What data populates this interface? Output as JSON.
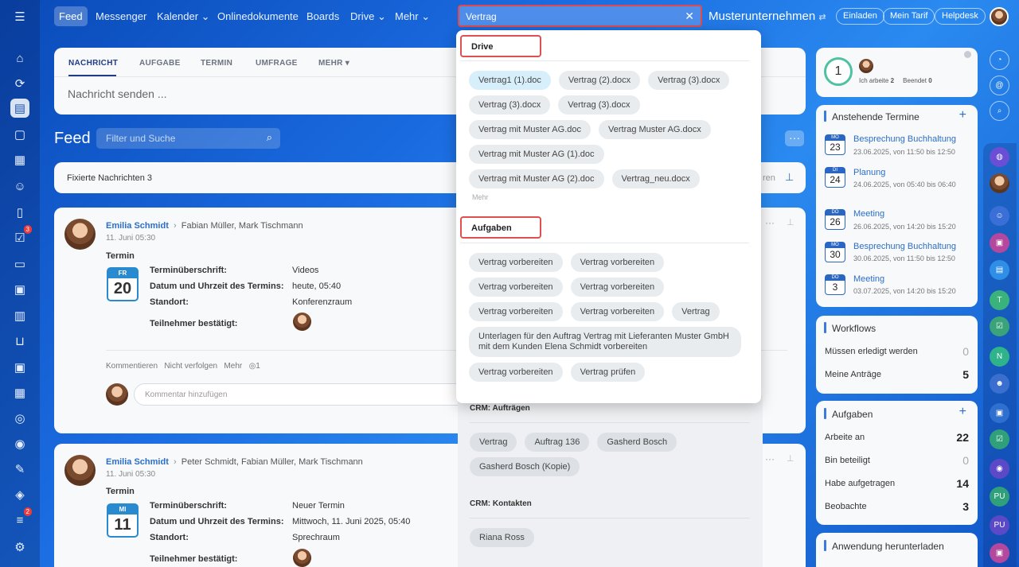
{
  "nav": {
    "items": [
      "Feed",
      "Messenger",
      "Kalender",
      "Onlinedokumente",
      "Boards",
      "Drive",
      "Mehr"
    ],
    "company": "Musterunternehmen",
    "buttons": [
      "Einladen",
      "Mein Tarif",
      "Helpdesk"
    ]
  },
  "search": {
    "value": "Vertrag"
  },
  "composer": {
    "tabs": [
      "NACHRICHT",
      "AUFGABE",
      "TERMIN",
      "UMFRAGE",
      "MEHR"
    ],
    "placeholder": "Nachricht senden ..."
  },
  "feed": {
    "title": "Feed",
    "filter_placeholder": "Filter und Suche",
    "pinned_label": "Fixierte Nachrichten",
    "pinned_count": "3",
    "pinned_right": "ren"
  },
  "posts": [
    {
      "author": "Emilia Schmidt",
      "recipients": "Fabian Müller, Mark Tischmann",
      "date": "11. Juni 05:30",
      "type": "Termin",
      "cal_month": "FR",
      "cal_day": "20",
      "label_title": "Terminüberschrift:",
      "value_title": "Videos",
      "label_datetime": "Datum und Uhrzeit des Termins:",
      "value_datetime": "heute, 05:40",
      "label_location": "Standort:",
      "value_location": "Konferenzraum",
      "label_participants": "Teilnehmer bestätigt:",
      "actions": [
        "Kommentieren",
        "Nicht verfolgen",
        "Mehr"
      ],
      "views": "1",
      "comment_placeholder": "Kommentar hinzufügen"
    },
    {
      "author": "Emilia Schmidt",
      "recipients": "Peter Schmidt, Fabian Müller, Mark Tischmann",
      "date": "11. Juni 05:30",
      "type": "Termin",
      "cal_month": "MI",
      "cal_day": "11",
      "label_title": "Terminüberschrift:",
      "value_title": "Neuer Termin",
      "label_datetime": "Datum und Uhrzeit des Termins:",
      "value_datetime": "Mittwoch, 11. Juni 2025, 05:40",
      "label_location": "Standort:",
      "value_location": "Sprechraum",
      "label_participants": "Teilnehmer bestätigt:"
    }
  ],
  "dropdown": {
    "drive_title": "Drive",
    "drive_items": [
      "Vertrag1 (1).doc",
      "Vertrag (2).docx",
      "Vertrag (3).docx",
      "Vertrag (3).docx",
      "Vertrag (3).docx",
      "Vertrag mit Muster AG.doc",
      "Vertrag Muster AG.docx",
      "Vertrag mit Muster AG (1).doc",
      "Vertrag mit Muster AG (2).doc",
      "Vertrag_neu.docx"
    ],
    "more": "Mehr",
    "tasks_title": "Aufgaben",
    "task_items": [
      "Vertrag vorbereiten",
      "Vertrag vorbereiten",
      "Vertrag vorbereiten",
      "Vertrag vorbereiten",
      "Vertrag vorbereiten",
      "Vertrag vorbereiten",
      "Vertrag",
      "Unterlagen für den Auftrag Vertrag mit Lieferanten Muster GmbH mit dem Kunden Elena Schmidt vorbereiten",
      "Vertrag vorbereiten",
      "Vertrag prüfen"
    ],
    "crm_orders_title": "CRM: Aufträgen",
    "crm_orders": [
      "Vertrag",
      "Auftrag 136",
      "Gasherd Bosch",
      "Gasherd Bosch (Kopie)"
    ],
    "crm_contacts_title": "CRM: Kontakten",
    "crm_contacts": [
      "Riana Ross"
    ]
  },
  "status": {
    "ring": "1",
    "working_label": "Ich arbeite",
    "working_count": "2",
    "done_label": "Beendet",
    "done_count": "0"
  },
  "events": {
    "title": "Anstehende Termine",
    "items": [
      {
        "month": "MO",
        "day": "23",
        "title": "Besprechung Buchhaltung",
        "time": "23.06.2025, von 11:50 bis 12:50"
      },
      {
        "month": "DI",
        "day": "24",
        "title": "Planung",
        "time": "24.06.2025, von 05:40 bis 06:40"
      },
      {
        "month": "DO",
        "day": "26",
        "title": "Meeting",
        "time": "26.06.2025, von 14:20 bis 15:20"
      },
      {
        "month": "MO",
        "day": "30",
        "title": "Besprechung Buchhaltung",
        "time": "30.06.2025, von 11:50 bis 12:50"
      },
      {
        "month": "DO",
        "day": "3",
        "title": "Meeting",
        "time": "03.07.2025, von 14:20 bis 15:20"
      }
    ]
  },
  "workflows": {
    "title": "Workflows",
    "rows": [
      {
        "label": "Müssen erledigt werden",
        "value": "0"
      },
      {
        "label": "Meine Anträge",
        "value": "5"
      }
    ]
  },
  "tasks": {
    "title": "Aufgaben",
    "rows": [
      {
        "label": "Arbeite an",
        "value": "22"
      },
      {
        "label": "Bin beteiligt",
        "value": "0"
      },
      {
        "label": "Habe aufgetragen",
        "value": "14"
      },
      {
        "label": "Beobachte",
        "value": "3"
      }
    ]
  },
  "download": {
    "title": "Anwendung herunterladen"
  },
  "sidebar": {
    "tasks_badge": "3",
    "feed_badge": "2"
  },
  "right_rail": {
    "t_label": "T",
    "n_label": "N",
    "pu_label": "PU"
  },
  "icons": {
    "menu": "hamburger-icon",
    "plus": "plus-icon",
    "pin": "pin-icon",
    "more": "more-dots-icon",
    "search": "magnifier-icon",
    "close": "close-icon",
    "eye": "eye-icon"
  },
  "colors": {
    "accent": "#2c6ec8",
    "highlight_border": "#e04a4a",
    "badge": "#ee3b3b"
  }
}
